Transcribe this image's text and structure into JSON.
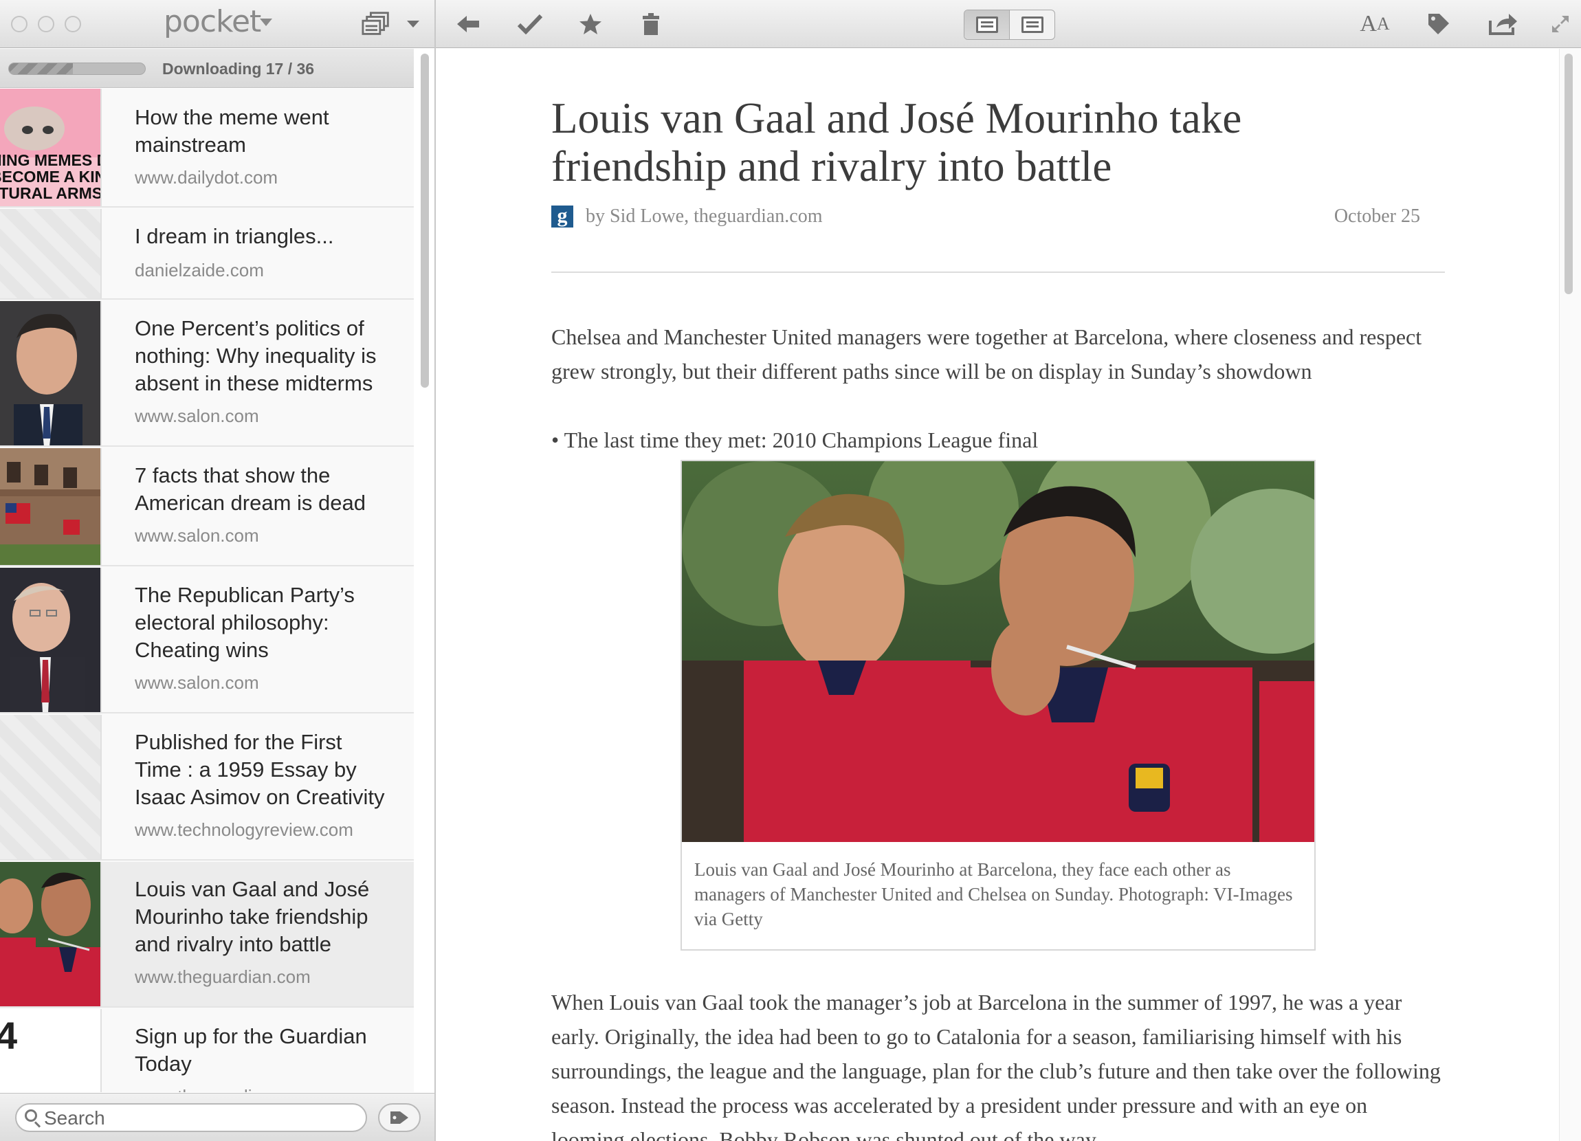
{
  "app": {
    "name": "pocket",
    "icons": [
      "back-icon",
      "check-icon",
      "star-icon",
      "trash-icon",
      "text-size-icon",
      "tag-icon",
      "share-icon",
      "fullscreen-icon",
      "list-view-icon"
    ]
  },
  "sidebar": {
    "download_status": "Downloading 17 / 36",
    "download_progress": 0.47,
    "items": [
      {
        "title": "How the meme went mainstream",
        "domain": "www.dailydot.com",
        "thumb_text": "NING MEMES D\nBECOME A KIN\nLTURAL ARMS"
      },
      {
        "title": "I dream in triangles...",
        "domain": "danielzaide.com"
      },
      {
        "title": "One Percent’s politics of nothing: Why inequality is absent in these midterms",
        "domain": "www.salon.com"
      },
      {
        "title": "7 facts that show the American dream is dead",
        "domain": "www.salon.com"
      },
      {
        "title": "The Republican Party’s electoral philosophy: Cheating wins",
        "domain": "www.salon.com"
      },
      {
        "title": "Published for the First Time : a 1959 Essay by Isaac Asimov on Creativity",
        "domain": "www.technologyreview.com"
      },
      {
        "title": "Louis van Gaal and José Mourinho take friendship and rivalry into battle",
        "domain": "www.theguardian.com"
      },
      {
        "title": "Sign up for the Guardian Today",
        "domain": "www.theguardian.com",
        "thumb_text": "4"
      }
    ],
    "search_placeholder": "Search"
  },
  "article": {
    "title": "Louis van Gaal and José Mourinho take friendship and rivalry into battle",
    "source_icon_letter": "g",
    "byline": "by Sid Lowe, theguardian.com",
    "date": "October 25",
    "intro": "Chelsea and Manchester United managers were together at Barcelona, where closeness and respect grew strongly, but their different paths since will be on display in Sunday’s showdown",
    "bullet": "• The last time they met: 2010 Champions League final",
    "caption": "Louis van Gaal and José Mourinho at Barcelona, they face each other as managers of Manchester United and Chelsea on Sunday. Photograph: VI-Images via Getty",
    "paragraph": "When Louis van Gaal took the manager’s job at Barcelona in the summer of 1997, he was a year early. Originally, the idea had been to go to Catalonia for a season, familiarising himself with his surroundings, the league and the language, plan for the club’s future and then take over the following season. Instead the process was accelerated by a president under pressure and with an eye on looming elections. Bobby Robson was shunted out of the way,"
  },
  "colors": {
    "chrome": "#dedede",
    "sidebar_bg": "#f9f9f9",
    "selected_bg": "#ececec",
    "guardian_blue": "#1f5b8f",
    "barca_red": "#c8203a"
  }
}
